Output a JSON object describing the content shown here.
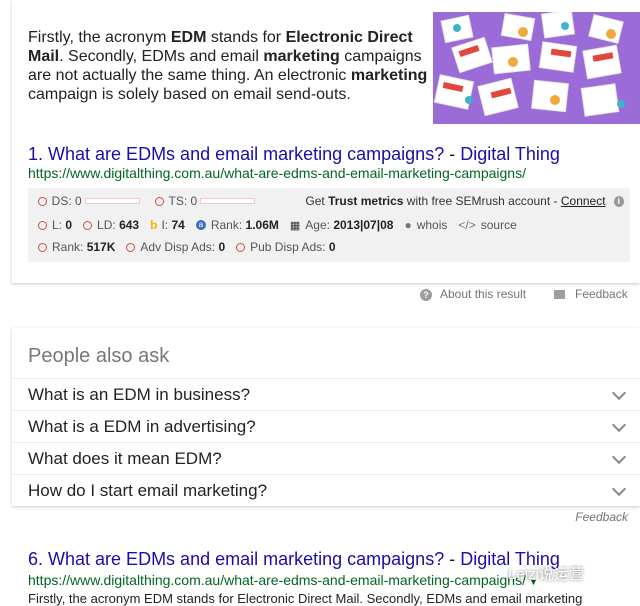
{
  "result1": {
    "snippet_parts": [
      {
        "text": "Firstly, the acronym ",
        "bold": false
      },
      {
        "text": "EDM",
        "bold": true
      },
      {
        "text": " stands for ",
        "bold": false
      },
      {
        "text": "Electronic Direct Mail",
        "bold": true
      },
      {
        "text": ". Secondly, EDMs and email ",
        "bold": false
      },
      {
        "text": "marketing",
        "bold": true
      },
      {
        "text": " campaigns are not actually the same thing. An electronic ",
        "bold": false
      },
      {
        "text": "marketing",
        "bold": true
      },
      {
        "text": " campaign is solely based on email send-outs.",
        "bold": false
      }
    ],
    "number": "1.",
    "title": "What are EDMs and email marketing campaigns?",
    "separator": " - ",
    "site": "Digital Thing",
    "url": "https://www.digitalthing.com.au/what-are-edms-and-email-marketing-campaigns/"
  },
  "seo": {
    "ds_label": "DS: 0",
    "ts_label": "TS: 0",
    "trust_prefix": "Get ",
    "trust_bold": "Trust metrics",
    "trust_suffix": " with free SEMrush account - ",
    "connect": "Connect",
    "l_label": "L:",
    "l_value": "0",
    "ld_label": "LD:",
    "ld_value": "643",
    "i_label": "I:",
    "i_value": "74",
    "rank_label": "Rank:",
    "rank_value": "1.06M",
    "age_label": "Age:",
    "age_value": "2013|07|08",
    "whois": "whois",
    "source": "source",
    "rank2_label": "Rank:",
    "rank2_value": "517K",
    "adv_label": "Adv Disp Ads:",
    "adv_value": "0",
    "pub_label": "Pub Disp Ads:",
    "pub_value": "0"
  },
  "meta": {
    "about": "About this result",
    "feedback": "Feedback"
  },
  "paa": {
    "title": "People also ask",
    "questions": [
      "What is an EDM in business?",
      "What is a EDM in advertising?",
      "What does it mean EDM?",
      "How do I start email marketing?"
    ],
    "feedback": "Feedback"
  },
  "result6": {
    "number": "6.",
    "title": "What are EDMs and email marketing campaigns?",
    "separator": " - ",
    "site": "Digital Thing",
    "url": "https://www.digitalthing.com.au/what-are-edms-and-email-marketing-campaigns/",
    "snippet": "Firstly, the acronym EDM stands for Electronic Direct Mail. Secondly, EDMs and email marketing"
  },
  "watermark": "Leizi说运营"
}
